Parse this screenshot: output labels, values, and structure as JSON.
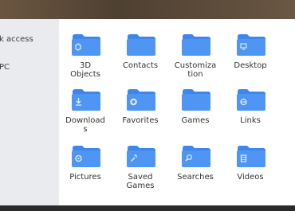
{
  "sidebar": {
    "items": [
      {
        "label": "k access"
      },
      {
        "label": "PC"
      }
    ]
  },
  "colors": {
    "folder_back": "#3d86ea",
    "folder_front": "#4f96f4",
    "glyph": "#e8f1ff"
  },
  "folders": [
    {
      "label": "3D\nObjects",
      "icon": "cube-icon"
    },
    {
      "label": "Contacts",
      "icon": "folder-icon"
    },
    {
      "label": "Customiza\ntion",
      "icon": "folder-icon"
    },
    {
      "label": "Desktop",
      "icon": "monitor-icon"
    },
    {
      "label": "Download\ns",
      "icon": "download-icon"
    },
    {
      "label": "Favorites",
      "icon": "gear-icon"
    },
    {
      "label": "Games",
      "icon": "folder-icon"
    },
    {
      "label": "Links",
      "icon": "globe-icon"
    },
    {
      "label": "Pictures",
      "icon": "image-icon"
    },
    {
      "label": "Saved\nGames",
      "icon": "wrench-icon"
    },
    {
      "label": "Searches",
      "icon": "search-icon"
    },
    {
      "label": "Videos",
      "icon": "film-icon"
    }
  ]
}
